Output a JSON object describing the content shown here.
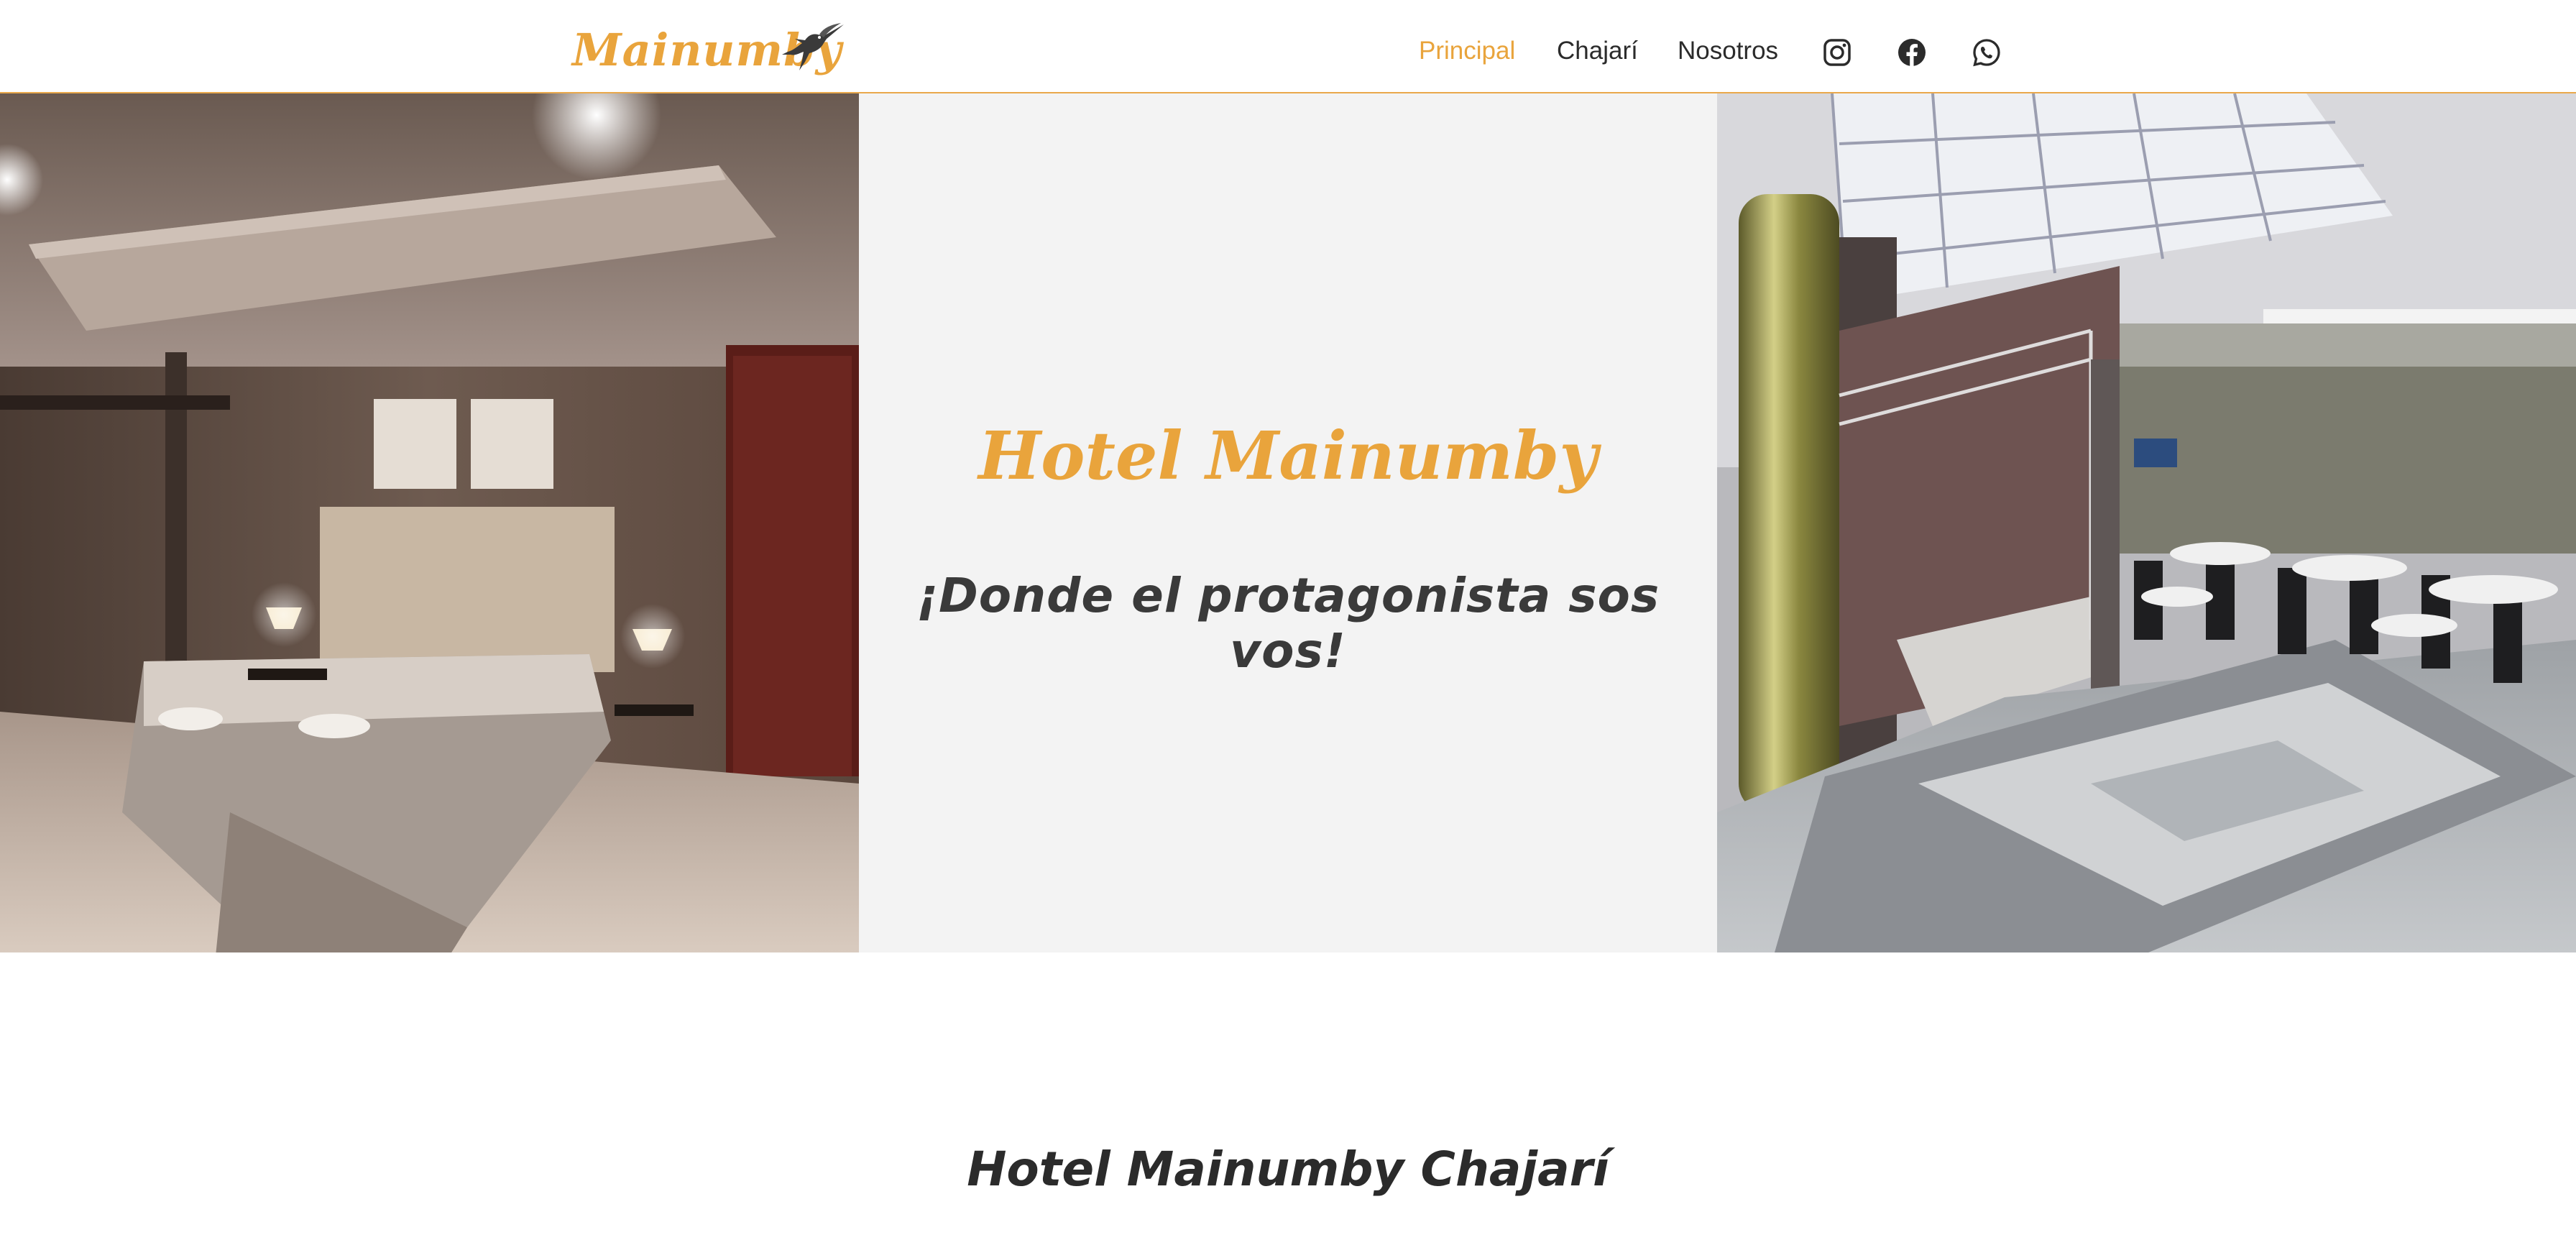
{
  "header": {
    "logo_text": "Mainumby",
    "logo_icon": "hummingbird-icon",
    "nav": [
      {
        "label": "Principal",
        "active": true
      },
      {
        "label": "Chajarí",
        "active": false
      },
      {
        "label": "Nosotros",
        "active": false
      }
    ],
    "social_icons": [
      "instagram-icon",
      "facebook-icon",
      "whatsapp-icon"
    ],
    "accent_color": "#e9a43c"
  },
  "hero": {
    "title": "Hotel Mainumby",
    "tagline": "¡Donde el protagonista sos vos!",
    "left_image": "hotel bedroom photo",
    "right_image": "hotel lobby dining area photo",
    "center_background": "#f3f3f3"
  },
  "section": {
    "title": "Hotel Mainumby Chajarí"
  }
}
